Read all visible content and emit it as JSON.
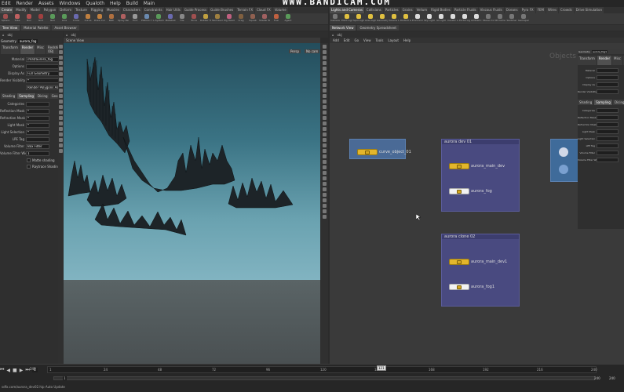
{
  "menubar": {
    "items": [
      "Edit",
      "Render",
      "Assets",
      "Windows",
      "Qualoth",
      "Help",
      "Build",
      "Main"
    ]
  },
  "watermark": "WWW.BANDICAM.COM",
  "shelf_left_tabs": [
    "Create",
    "Modify",
    "Model",
    "Polygon",
    "Deform",
    "Texture",
    "Rigging",
    "Muscles",
    "Characters",
    "Constraints",
    "Hair Utils",
    "Guide Process",
    "Guide Brushes",
    "Terrain FX",
    "Cloud FX",
    "Volume"
  ],
  "shelf_left_tools": [
    {
      "label": "Sphere",
      "color": "#a05050"
    },
    {
      "label": "Tube",
      "color": "#c06060"
    },
    {
      "label": "Box",
      "color": "#b05050"
    },
    {
      "label": "Grid",
      "color": "#a04040"
    },
    {
      "label": "Null",
      "color": "#5a9a5a"
    },
    {
      "label": "Line",
      "color": "#5a9a5a"
    },
    {
      "label": "Circle",
      "color": "#6a6ab0"
    },
    {
      "label": "Curve",
      "color": "#c08040"
    },
    {
      "label": "Draw Curve",
      "color": "#c08040"
    },
    {
      "label": "Path",
      "color": "#b07040"
    },
    {
      "label": "Spray Paint",
      "color": "#b06060"
    },
    {
      "label": "Font",
      "color": "#999999"
    },
    {
      "label": "Platonic Solids",
      "color": "#6a8ab0"
    },
    {
      "label": "L-System",
      "color": "#5a9a5a"
    },
    {
      "label": "Metaball",
      "color": "#6a6ab0"
    },
    {
      "label": "File",
      "color": "#888888"
    },
    {
      "label": "Torus",
      "color": "#a05050"
    },
    {
      "label": "Rubber Toy",
      "color": "#c0a040"
    },
    {
      "label": "Test Geometry",
      "color": "#a08040"
    },
    {
      "label": "Pig Head",
      "color": "#c06080"
    },
    {
      "label": "Crag",
      "color": "#806040"
    },
    {
      "label": "Squab",
      "color": "#906050"
    },
    {
      "label": "Shader Ball",
      "color": "#a06060"
    },
    {
      "label": "Fuel",
      "color": "#c06040"
    },
    {
      "label": "Agent",
      "color": "#5a9a5a"
    }
  ],
  "shelf_right_tabs": [
    "Lights and Cameras",
    "Collisions",
    "Particles",
    "Grains",
    "Vellum",
    "Rigid Bodies",
    "Particle Fluids",
    "Viscous Fluids",
    "Oceans",
    "Pyro FX",
    "FEM",
    "Wires",
    "Crowds",
    "Drive Simulation"
  ],
  "shelf_right_tools": [
    {
      "label": "Camera",
      "color": "#777777"
    },
    {
      "label": "Point Light",
      "color": "#e0c040"
    },
    {
      "label": "Spot Light",
      "color": "#e0c040"
    },
    {
      "label": "Area Light",
      "color": "#e0c040"
    },
    {
      "label": "Geometry Light",
      "color": "#e0c040"
    },
    {
      "label": "Volume Light",
      "color": "#e0c040"
    },
    {
      "label": "Distant Light",
      "color": "#e0c040"
    },
    {
      "label": "Environment Light",
      "color": "#dddddd"
    },
    {
      "label": "Sky Light",
      "color": "#dddddd"
    },
    {
      "label": "GI Light",
      "color": "#dddddd"
    },
    {
      "label": "Caustic Light",
      "color": "#dddddd"
    },
    {
      "label": "Portal Light",
      "color": "#dddddd"
    },
    {
      "label": "Ambient Light",
      "color": "#dddddd"
    },
    {
      "label": "Stereo Camera",
      "color": "#777777"
    },
    {
      "label": "VR Camera",
      "color": "#777777"
    },
    {
      "label": "Switcher",
      "color": "#777777"
    },
    {
      "label": "Gamepad Camera",
      "color": "#777777"
    }
  ],
  "left_panel": {
    "tabs": [
      "Tree View",
      "Material Palette",
      "Asset Browser"
    ],
    "path": "obj",
    "node_type": "Geometry",
    "node_name": "aurora_fog",
    "subtabs": [
      "Transform",
      "Render",
      "Misc",
      "Redshift OBJ"
    ],
    "params": [
      {
        "label": "Material",
        "value": "/mat/aurora_fog"
      },
      {
        "label": "Options",
        "value": ""
      },
      {
        "label": "Display As",
        "value": "Full Geometry"
      },
      {
        "label": "Render Visibility",
        "value": "*"
      },
      {
        "label": "",
        "value": "Render Polygons As Subdivision"
      }
    ],
    "subtabs2": [
      "Shading",
      "Sampling",
      "Dicing",
      "Geometry"
    ],
    "params2": [
      {
        "label": "Categories",
        "value": ""
      },
      {
        "label": "Reflection Mask",
        "value": "*"
      },
      {
        "label": "Refraction Mask",
        "value": "*"
      },
      {
        "label": "Light Mask",
        "value": "*"
      },
      {
        "label": "Light Selection",
        "value": "*"
      },
      {
        "label": "LPE Tag",
        "value": ""
      },
      {
        "label": "Volume Filter",
        "value": "Box Filter"
      },
      {
        "label": "Volume Filter Width",
        "value": "1"
      }
    ],
    "checks": [
      "Matte shading",
      "Raytrace Shading"
    ]
  },
  "viewport": {
    "tab_label": "Scene View",
    "persp_label": "Persp",
    "cam_label": "No cam",
    "path": "obj"
  },
  "network": {
    "tabs": [
      "Network View",
      "Geometry Spreadsheet"
    ],
    "path": "obj",
    "menu": [
      "Add",
      "Edit",
      "Go",
      "View",
      "Tools",
      "Layout",
      "Help"
    ],
    "context_label": "Objects",
    "boxes": [
      {
        "title": "aurora dev 01",
        "nodes": [
          "aurora_main_dev",
          "aurora_fog"
        ]
      },
      {
        "title": "aurora clone 02",
        "nodes": [
          "aurora_main_dev1",
          "aurora_fog1"
        ]
      }
    ],
    "loose_node": "curve_object_01"
  },
  "right_params": {
    "node_type": "Geometry",
    "node_name": "aurora_fog1",
    "subtabs": [
      "Transform",
      "Render",
      "Misc",
      "Redshift OBJ"
    ],
    "params": [
      {
        "label": "Material",
        "value": ""
      },
      {
        "label": "Options",
        "value": ""
      },
      {
        "label": "Display As",
        "value": ""
      },
      {
        "label": "Render Visibility",
        "value": ""
      }
    ],
    "subtabs2": [
      "Shading",
      "Sampling",
      "Dicing"
    ],
    "params2": [
      {
        "label": "Categories",
        "value": ""
      },
      {
        "label": "Reflection Mask",
        "value": ""
      },
      {
        "label": "Refraction Mask",
        "value": ""
      },
      {
        "label": "Light Mask",
        "value": ""
      },
      {
        "label": "Light Selection",
        "value": ""
      },
      {
        "label": "LPE Tag",
        "value": ""
      },
      {
        "label": "Volume Filter",
        "value": ""
      },
      {
        "label": "Volume Filter Width",
        "value": ""
      }
    ]
  },
  "timeline": {
    "current_frame": "1",
    "start": "1",
    "end": "240",
    "end2": "240",
    "range": "240",
    "ruler_marks": [
      "1",
      "24",
      "48",
      "72",
      "96",
      "120",
      "144",
      "168",
      "192",
      "216",
      "240"
    ],
    "marker_frame": "121",
    "status": "sdfx.com/aurora_dev02.hip  Auto Update"
  }
}
